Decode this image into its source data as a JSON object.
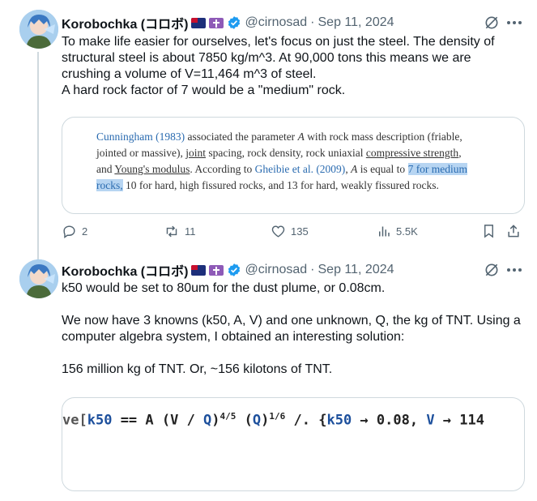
{
  "tweets": [
    {
      "author_name": "Korobochka (コロボ)",
      "handle": "@cirnosad",
      "separator": "·",
      "date": "Sep 11, 2024",
      "text": "To make life easier for ourselves, let's focus on just the steel. The density of structural steel is about 7850 kg/m^3. At 90,000 tons this means we are crushing a volume of V=11,464 m^3 of steel.\nA hard rock factor of 7 would be a \"medium\" rock.",
      "quoted_image": {
        "seg1_link": "Cunningham (1983)",
        "seg2": " associated the parameter ",
        "seg3_italic": "A",
        "seg4": " with rock mass description (friable, jointed or massive), ",
        "seg5_ul": "joint",
        "seg6": " spacing, rock density, rock uniaxial ",
        "seg7_ul": "compressive strength",
        "seg8": ", and ",
        "seg9_ul": "Young's modulus",
        "seg10": ". According to ",
        "seg11_link": "Gheibie et al. (2009)",
        "seg12": ", ",
        "seg13_italic": "A",
        "seg14": " is equal to ",
        "seg15_hl": "7 for medium rocks,",
        "seg16": " 10 for hard, high fissured rocks, and 13 for hard, weakly fissured rocks."
      },
      "actions": {
        "replies": "2",
        "reposts": "11",
        "likes": "135",
        "views": "5.5K"
      }
    },
    {
      "author_name": "Korobochka (コロボ)",
      "handle": "@cirnosad",
      "separator": "·",
      "date": "Sep 11, 2024",
      "text": "k50 would be set to 80um for the dust plume, or 0.08cm.\n\nWe now have 3 knowns (k50, A, V) and one unknown, Q, the kg of TNT. Using a computer algebra system, I obtained an interesting solution:\n\n156 million kg of TNT. Or, ~156 kilotons of TNT.",
      "quoted_image": {
        "m1": "ve",
        "m2": "[",
        "m3": "k50",
        "m4": " == A (V / ",
        "m5": "Q",
        "m6": ")",
        "m7": "4/5",
        "m8": " (",
        "m9": "Q",
        "m10": ")",
        "m11": "1/6",
        "m12": " /. {",
        "m13": "k50",
        "m14": " → 0.08, ",
        "m15": "V",
        "m16": " → 114"
      }
    }
  ],
  "icons": {
    "flag_1": "australia-flag-icon",
    "flag_2": "cross-icon",
    "verified": "verified-badge-icon",
    "grok": "grok-icon",
    "more": "more-icon",
    "reply": "reply-icon",
    "repost": "repost-icon",
    "like": "like-icon",
    "views": "views-icon",
    "bookmark": "bookmark-icon",
    "share": "share-icon"
  },
  "colors": {
    "accent": "#1d9bf0",
    "secondary_text": "#536471",
    "border": "#cfd9de"
  }
}
